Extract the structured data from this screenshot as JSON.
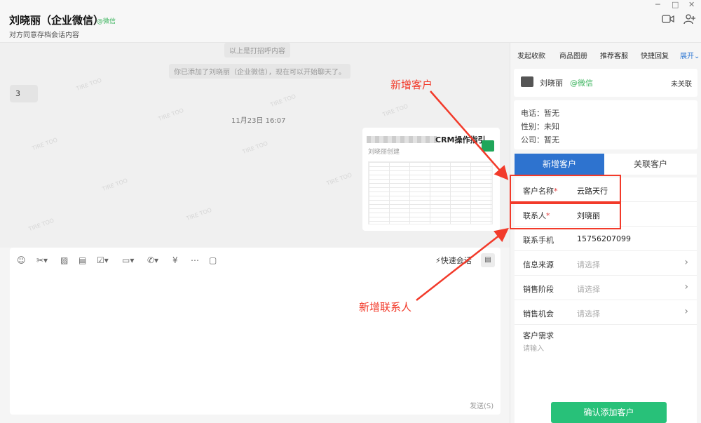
{
  "header": {
    "contact_name": "刘晓丽（企业微信）",
    "wechat_tag": "@微信",
    "subtitle": "对方同意存档会话内容"
  },
  "window": {
    "minimize": "─",
    "maximize": "□",
    "close": "✕"
  },
  "chat": {
    "system_messages": [
      "以上是打招呼内容",
      "你已添加了刘晓丽（企业微信），现在可以开始聊天了。"
    ],
    "incoming_message": "3",
    "timestamp": "11月23日 16:07",
    "watermark": "TIRE TOO",
    "doc_card": {
      "title": "CRM操作指引",
      "author": "刘晓丽创建"
    }
  },
  "composer": {
    "quick_reply": "快速会话",
    "send": "发送(S)"
  },
  "side_panel": {
    "tabs": [
      "发起收款",
      "商品图册",
      "推荐客服",
      "快捷回复"
    ],
    "expand": "展开",
    "contact_card": {
      "name": "刘晓丽",
      "wechat": "@微信",
      "status": "未关联"
    },
    "info": {
      "phone_label": "电话：",
      "phone_value": "暂无",
      "gender_label": "性别：",
      "gender_value": "未知",
      "company_label": "公司：",
      "company_value": "暂无"
    },
    "tab_new_customer": "新增客户",
    "tab_link_customer": "关联客户",
    "form": {
      "customer_name_label": "客户名称",
      "customer_name_value": "云路天行",
      "contact_label": "联系人",
      "contact_value": "刘晓丽",
      "phone_label": "联系手机",
      "phone_value": "15756207099",
      "source_label": "信息来源",
      "source_placeholder": "请选择",
      "stage_label": "销售阶段",
      "stage_placeholder": "请选择",
      "opportunity_label": "销售机会",
      "opportunity_placeholder": "请选择",
      "requirement_label": "客户需求",
      "requirement_placeholder": "请输入",
      "required_mark": "*"
    },
    "submit": "确认添加客户"
  },
  "annotations": {
    "new_customer": "新增客户",
    "new_contact": "新增联系人",
    "color": "#f23a2a"
  }
}
